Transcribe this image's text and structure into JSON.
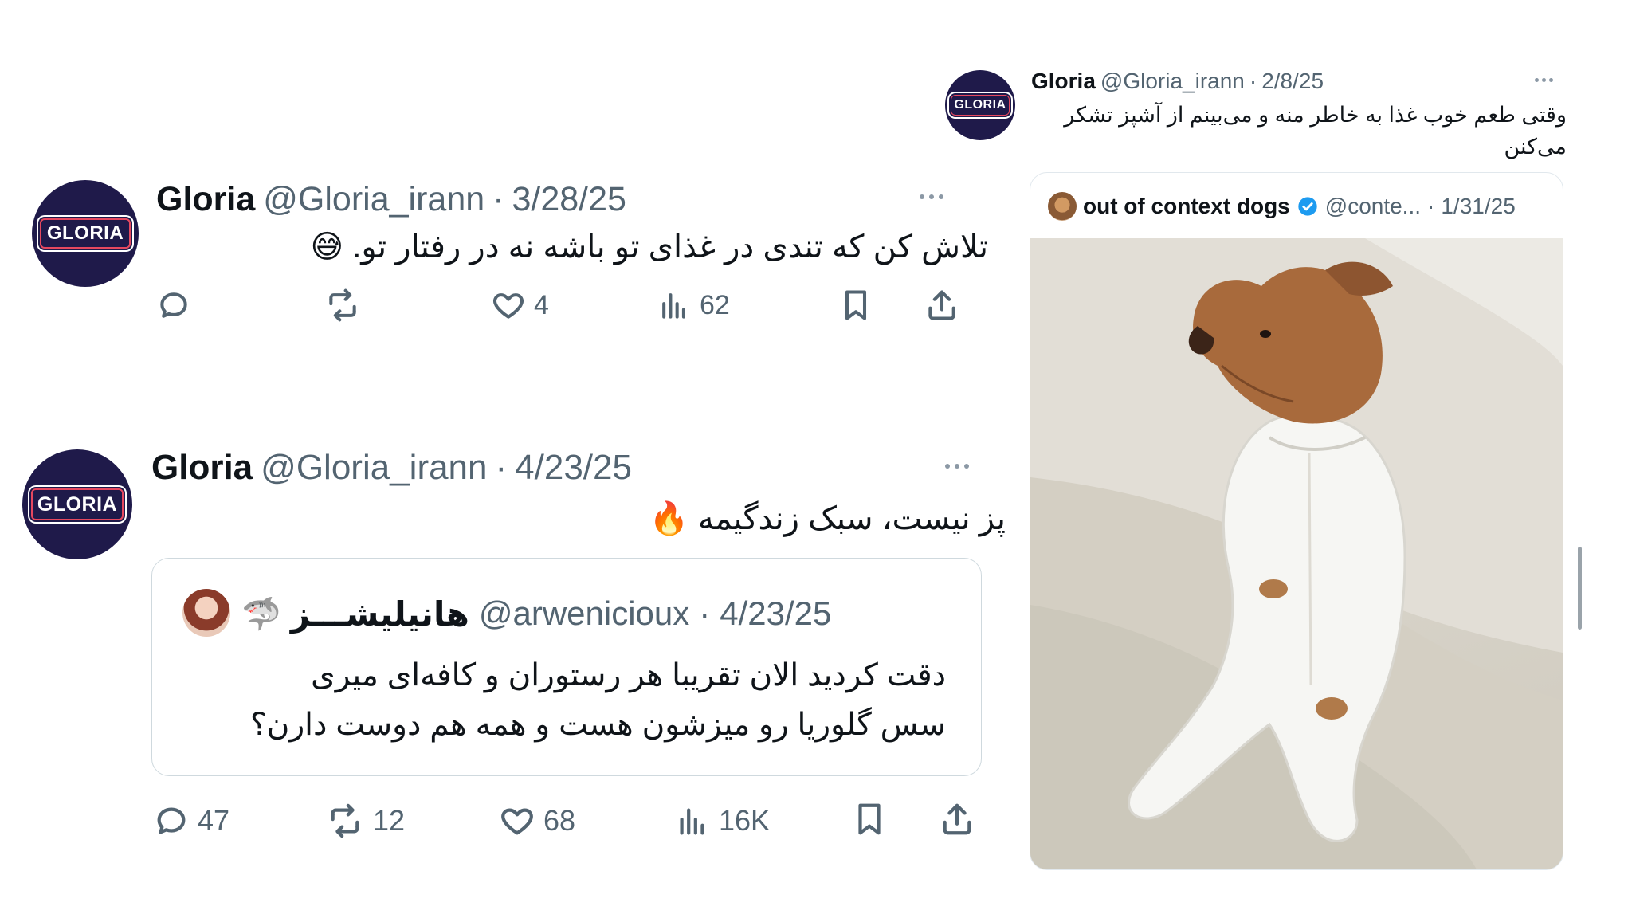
{
  "tweet1": {
    "avatar_text": "GLORIA",
    "name": "Gloria",
    "handle": "@Gloria_irann",
    "sep": "·",
    "date": "3/28/25",
    "text": "تلاش کن که تندی در غذای تو باشه نه در رفتار تو.",
    "emoji": "😅",
    "replies": "",
    "retweets": "",
    "likes": "4",
    "views": "62"
  },
  "tweet2": {
    "avatar_text": "GLORIA",
    "name": "Gloria",
    "handle": "@Gloria_irann",
    "sep": "·",
    "date": "4/23/25",
    "text": "پز نیست، سبک زندگیمه",
    "emoji": "🔥",
    "quote": {
      "name": "هانیلیشـــز",
      "shark_emoji": "🦈",
      "handle": "@arwenicioux",
      "sep": "·",
      "date": "4/23/25",
      "text_line1": "دقت کردید الان تقریبا هر رستوران و کافه‌ای میری",
      "text_line2": "سس گلوریا رو میزشون هست و همه هم دوست دارن؟"
    },
    "replies": "47",
    "retweets": "12",
    "likes": "68",
    "views": "16K"
  },
  "tweet3": {
    "avatar_text": "GLORIA",
    "name": "Gloria",
    "handle": "@Gloria_irann",
    "sep": "·",
    "date": "2/8/25",
    "text_line1": "وقتی طعم خوب غذا به خاطر منه و می‌بینم از آشپز تشکر",
    "text_line2": "می‌کنن",
    "quote": {
      "name": "out of context dogs",
      "handle": "@conte...",
      "sep": "·",
      "date": "1/31/25",
      "image_alt": "dog in white pajamas sitting on sofa"
    }
  },
  "colors": {
    "avatar_bg": "#1f1a4a",
    "logo_border": "#e6485f",
    "verified": "#1d9bf0",
    "muted": "#536471"
  }
}
